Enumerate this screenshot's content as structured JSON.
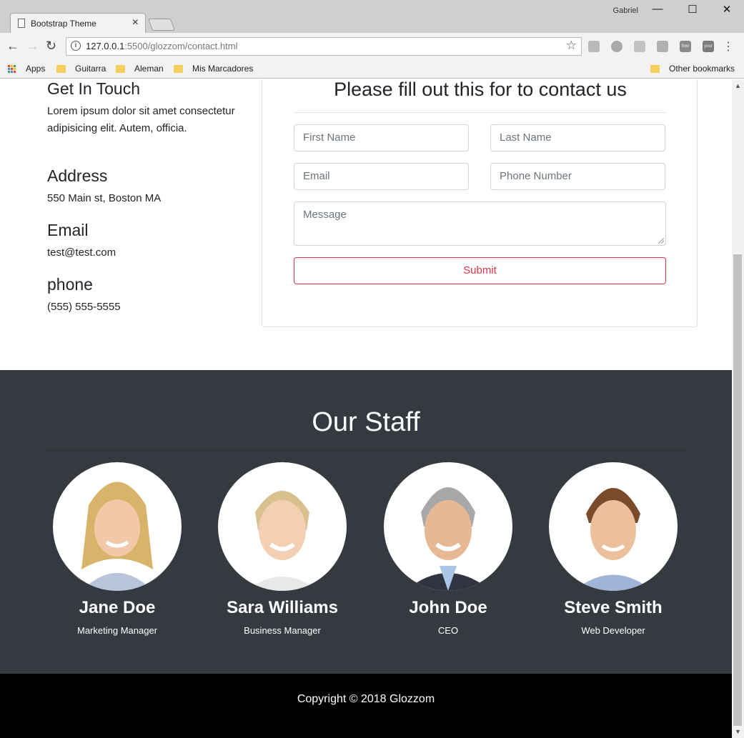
{
  "browser": {
    "tab_title": "Bootstrap Theme",
    "tab_close": "×",
    "user": "Gabriel",
    "url_host": "127.0.0.1",
    "url_rest": ":5500/glozzom/contact.html",
    "bookmarks": [
      "Apps",
      "Guitarra",
      "Aleman",
      "Mis Marcadores"
    ],
    "other_bookmarks": "Other bookmarks",
    "ext_labels": [
      "flow",
      "your"
    ]
  },
  "contact": {
    "get_in_touch_title": "Get In Touch",
    "get_in_touch_text": "Lorem ipsum dolor sit amet consectetur adipisicing elit. Autem, officia.",
    "address_title": "Address",
    "address_text": "550 Main st, Boston MA",
    "email_title": "Email",
    "email_text": "test@test.com",
    "phone_title": "phone",
    "phone_text": "(555) 555-5555"
  },
  "form": {
    "heading": "Please fill out this for to contact us",
    "first_name_placeholder": "First Name",
    "last_name_placeholder": "Last Name",
    "email_placeholder": "Email",
    "phone_placeholder": "Phone Number",
    "message_placeholder": "Message",
    "submit_label": "Submit"
  },
  "staff": {
    "heading": "Our Staff",
    "members": [
      {
        "name": "Jane Doe",
        "role": "Marketing Manager"
      },
      {
        "name": "Sara Williams",
        "role": "Business Manager"
      },
      {
        "name": "John Doe",
        "role": "CEO"
      },
      {
        "name": "Steve Smith",
        "role": "Web Developer"
      }
    ]
  },
  "footer": {
    "copyright": "Copyright © 2018 Glozzom"
  },
  "colors": {
    "staff_bg": "#343a40",
    "submit_red": "#dc3545",
    "footer_bg": "#000000"
  }
}
